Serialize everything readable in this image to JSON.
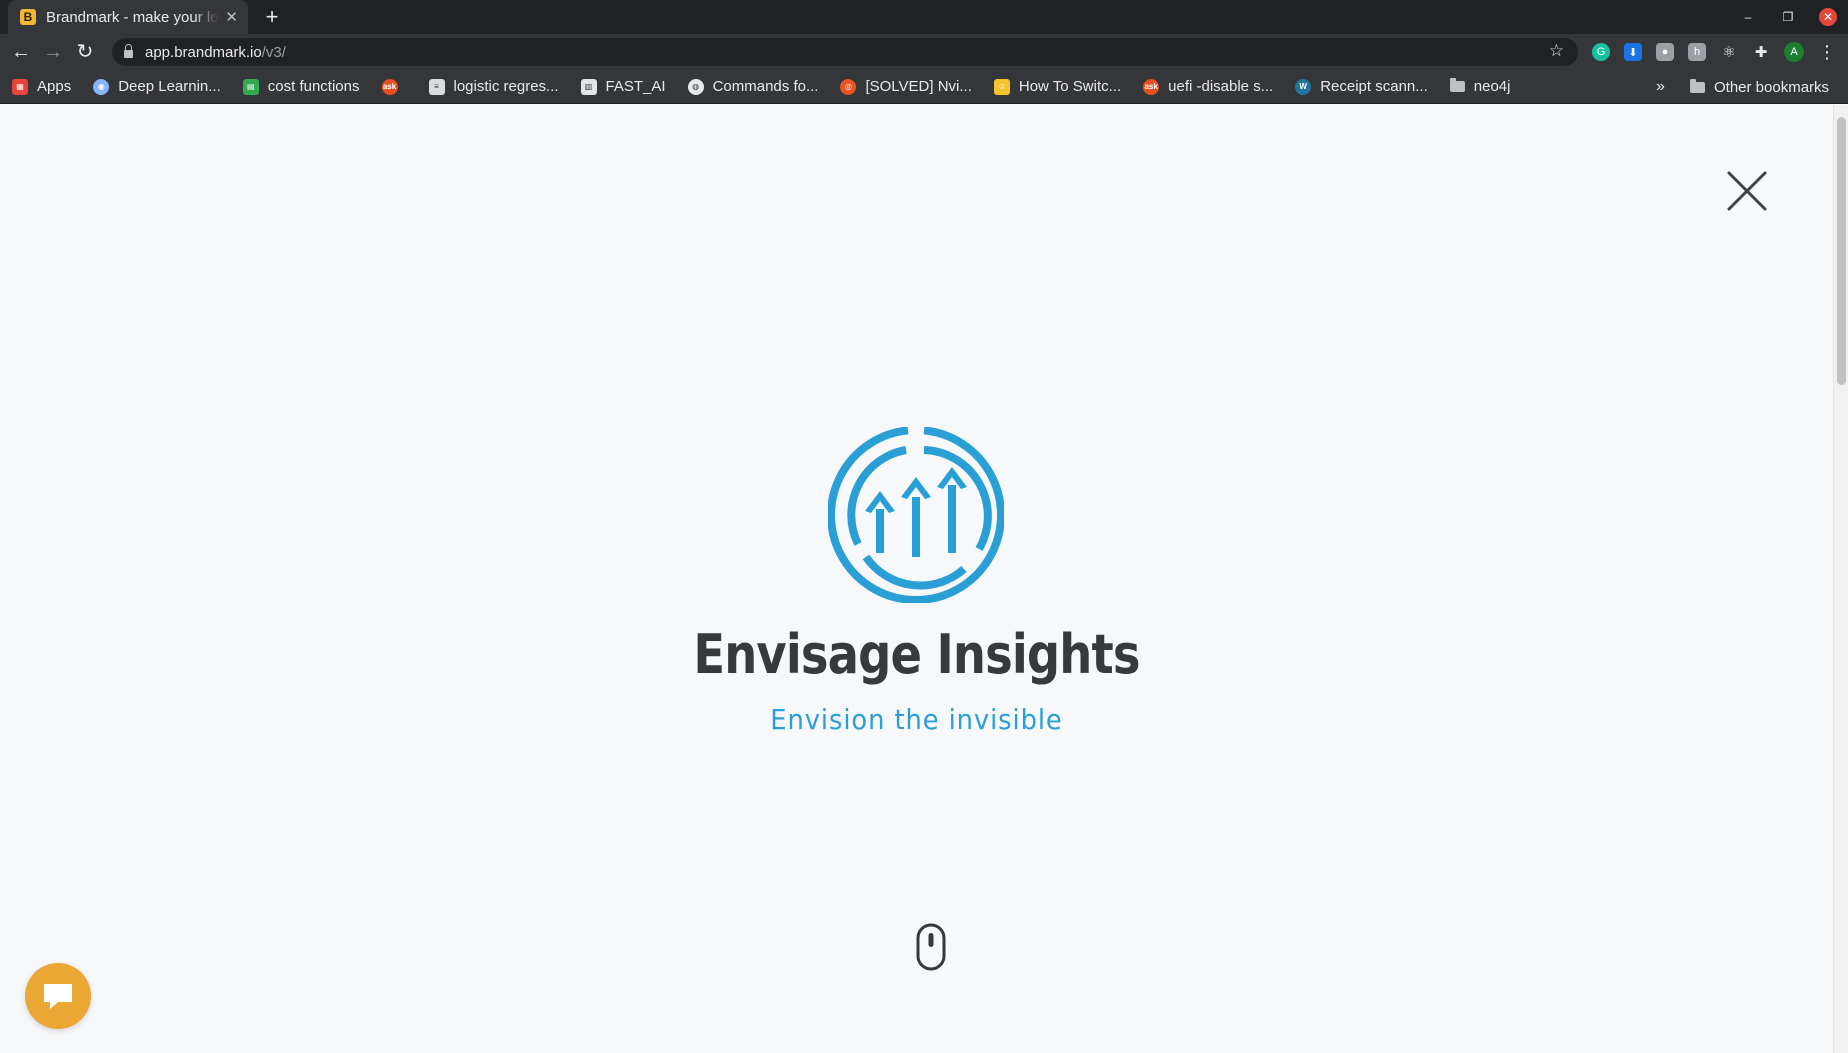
{
  "browser": {
    "tab": {
      "favicon_letter": "B",
      "title": "Brandmark - make your logo"
    },
    "url": {
      "host": "app.brandmark.io",
      "path": "/v3/"
    },
    "profile_initial": "A",
    "bookmarks": [
      {
        "label": "Apps",
        "icon": "apps-grid-icon",
        "color": "#e8453c"
      },
      {
        "label": "Deep Learnin...",
        "icon": "brain-icon",
        "color": "#8ab4f8"
      },
      {
        "label": "cost functions",
        "icon": "pixel-grid-icon",
        "color": "#34a853"
      },
      {
        "label": "",
        "icon": "ask-icon",
        "color": "#e8501d"
      },
      {
        "label": "logistic regres...",
        "icon": "document-icon",
        "color": "#dadce0"
      },
      {
        "label": "FAST_AI",
        "icon": "notebook-icon",
        "color": "#e3e6e8"
      },
      {
        "label": "Commands fo...",
        "icon": "globe-icon",
        "color": "#e8eaed"
      },
      {
        "label": "[SOLVED] Nvi...",
        "icon": "ubuntu-icon",
        "color": "#e95420"
      },
      {
        "label": "How To Switc...",
        "icon": "avatar-icon",
        "color": "#f4c430"
      },
      {
        "label": "uefi -disable s...",
        "icon": "ask-icon",
        "color": "#e8501d"
      },
      {
        "label": "Receipt scann...",
        "icon": "wordpress-icon",
        "color": "#21759b"
      },
      {
        "label": "neo4j",
        "icon": "folder-icon",
        "color": "#bdc1c6"
      }
    ],
    "other_bookmarks": "Other bookmarks"
  },
  "page": {
    "brand_name": "Envisage Insights",
    "slogan": "Envision the invisible",
    "colors": {
      "logo": "#2a9fd6",
      "brand_name": "#363a3d",
      "chat": "#eba733"
    }
  }
}
